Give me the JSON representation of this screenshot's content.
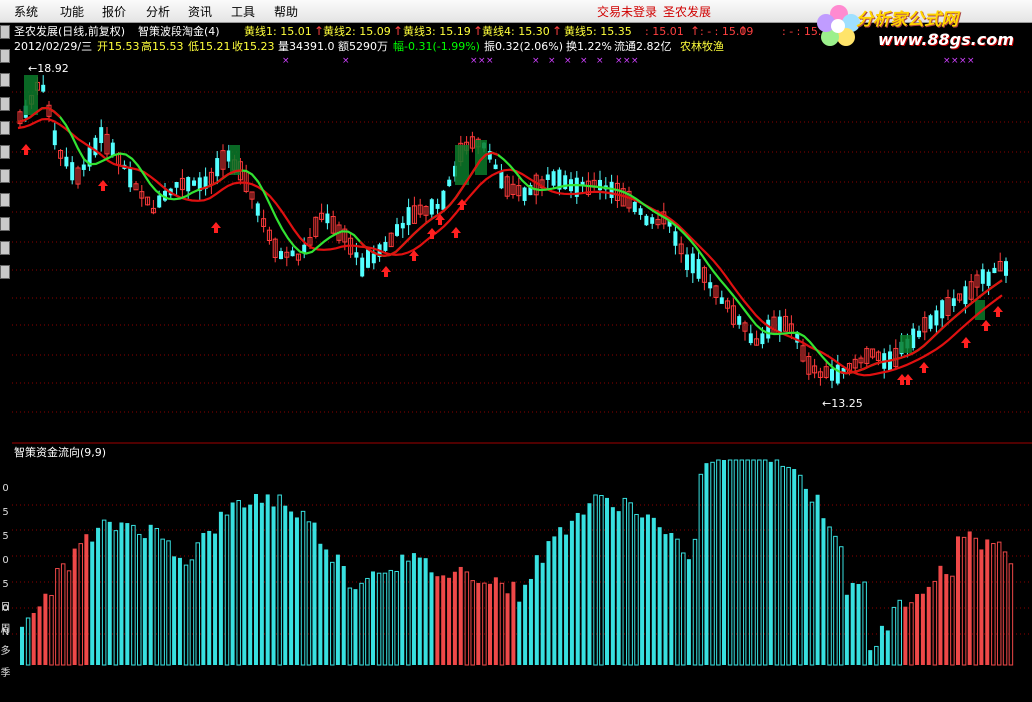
{
  "menu": {
    "items": [
      "系统",
      "功能",
      "报价",
      "分析",
      "资讯",
      "工具",
      "帮助"
    ],
    "login_status": "交易未登录",
    "stock_name_status": "圣农发展"
  },
  "watermark": {
    "text": "分析家公式网",
    "url": "www.88gs.com"
  },
  "sidebar": {
    "icons": [
      "report-icon",
      "list-icon",
      "grid-icon",
      "chart-icon",
      "zoom-icon",
      "si-icon",
      "flag-icon",
      "move-icon",
      "target-icon",
      "pen-icon",
      "five-icon"
    ],
    "labels": [
      "日",
      "周",
      "多",
      "季"
    ],
    "axis_labels": [
      "0",
      "5",
      "5",
      "0",
      "5",
      "0",
      "N"
    ]
  },
  "main_panel": {
    "title_prefix": "圣农发展(日线,前复权)",
    "indicator_name": "智策波段淘金(4)",
    "lines": [
      {
        "label": "黄线1: 15.01",
        "arrow": "↑"
      },
      {
        "label": "黄线2: 15.09",
        "arrow": "↑"
      },
      {
        "label": "黄线3: 15.19",
        "arrow": "↑"
      },
      {
        "label": "黄线4: 15.30",
        "arrow": "↑"
      },
      {
        "label": "黄线5: 15.35",
        "arrow": ""
      },
      {
        "label": ": 15.01",
        "arrow": "↑"
      },
      {
        "label": ": - : 15.09",
        "arrow": "↑"
      },
      {
        "label": ": - : 15.19",
        "arrow": "↑"
      }
    ],
    "info": {
      "date": "2012/02/29/三",
      "open": "开15.53",
      "high": "高15.53",
      "low": "低15.21",
      "close": "收15.23",
      "volume": "量34391.0",
      "amount": "额5290万",
      "change": "幅-0.31(-1.99%)",
      "amplitude": "振0.32(2.06%)",
      "turnover": "换1.22%",
      "float": "流通2.82亿",
      "sector": "农林牧渔"
    },
    "high_marker": "18.92",
    "low_marker": "13.25"
  },
  "sub_panel": {
    "title": "智策资金流向(9,9)"
  },
  "colors": {
    "up": "#ff3b3b",
    "down": "#54ffff",
    "ma_green": "#32e232",
    "ma_red": "#e01010",
    "buy_arrow": "#ff2020",
    "x_marker": "#d040ff",
    "bar_up": "#ee4848",
    "bar_down": "#38e0e0",
    "grid": "#8b0000",
    "yellow_text": "#ffff3c",
    "info_text": "#ffffff"
  }
}
